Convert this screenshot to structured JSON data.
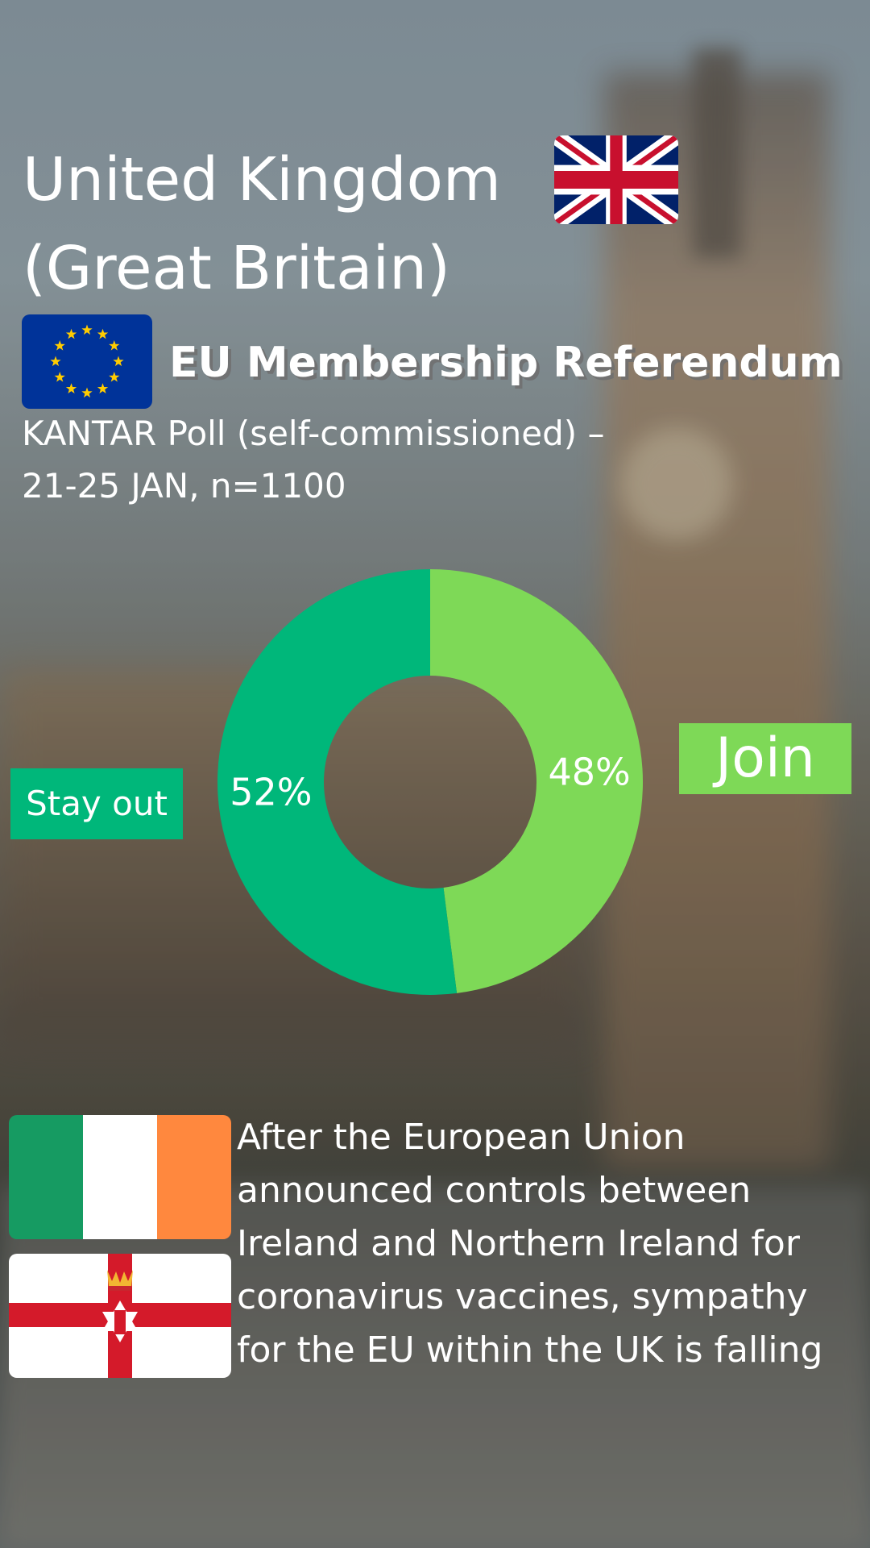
{
  "header": {
    "title_line1": "United Kingdom",
    "title_line2": "(Great Britain)",
    "subtitle": "EU Membership Referendum",
    "poll_line1": "KANTAR Poll (self-commissioned) –",
    "poll_line2": "21-25 JAN, n=1100"
  },
  "flags": {
    "uk": "flag-united-kingdom",
    "eu": "flag-european-union",
    "ie": "flag-ireland",
    "ni": "flag-northern-ireland"
  },
  "colors": {
    "stay_out": "#00b77a",
    "join": "#7ed957"
  },
  "chart_data": {
    "type": "pie",
    "categories": [
      "Join",
      "Stay out"
    ],
    "values": [
      48,
      52
    ],
    "labels": [
      "48%",
      "52%"
    ],
    "colors": [
      "#7ed957",
      "#00b77a"
    ],
    "donut": true,
    "title": "",
    "legend": [
      "Stay out",
      "Join"
    ]
  },
  "legend": {
    "stay_out": "Stay out",
    "join": "Join"
  },
  "news": {
    "line1": "After the European Union",
    "line2": "announced controls between",
    "line3": "Ireland and Northern Ireland for",
    "line4": "coronavirus vaccines, sympathy",
    "line5": "for the EU within the UK is falling"
  }
}
